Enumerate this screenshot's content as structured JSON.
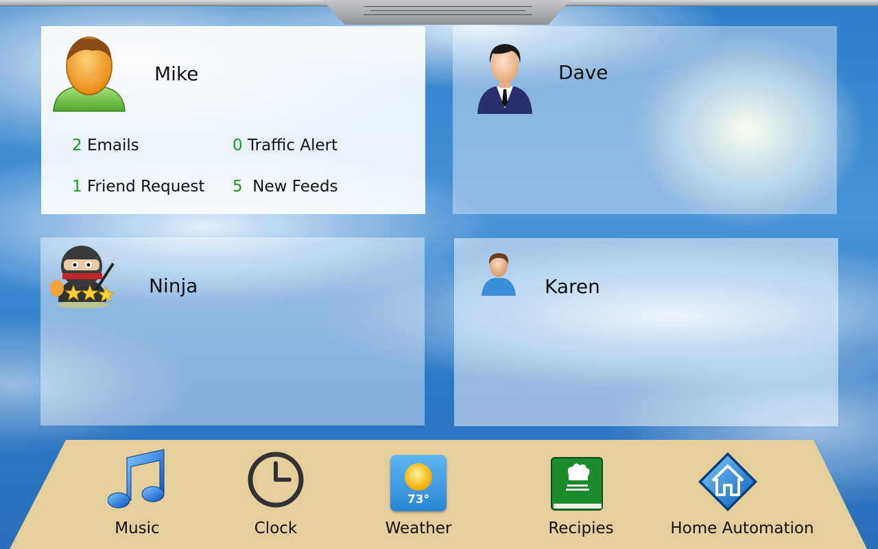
{
  "users": {
    "mike": {
      "name": "Mike",
      "avatar_icon": "green-user-icon",
      "stats": [
        {
          "count": "2",
          "label": "Emails"
        },
        {
          "count": "0",
          "label": "Traffic Alert"
        },
        {
          "count": "1",
          "label": "Friend Request"
        },
        {
          "count": "5",
          "label": " New Feeds"
        }
      ]
    },
    "dave": {
      "name": "Dave",
      "avatar_icon": "businessman-icon"
    },
    "ninja": {
      "name": "Ninja",
      "avatar_icon": "ninja-icon"
    },
    "karen": {
      "name": "Karen",
      "avatar_icon": "blue-user-icon"
    }
  },
  "dock": {
    "apps": [
      {
        "label": "Music",
        "icon": "music-note-icon"
      },
      {
        "label": "Clock",
        "icon": "clock-icon"
      },
      {
        "label": "Weather",
        "icon": "weather-sun-icon",
        "temperature": "73°"
      },
      {
        "label": "Recipies",
        "icon": "recipe-book-icon"
      },
      {
        "label": "Home Automation",
        "icon": "home-icon"
      }
    ]
  },
  "colors": {
    "count_green": "#1a9a1a",
    "dock_background": "#e3cf9c",
    "sky_blue": "#2f7fc8"
  }
}
